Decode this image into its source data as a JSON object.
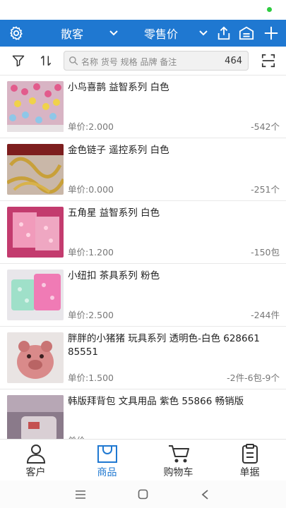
{
  "toolbar": {
    "customer": "散客",
    "price_type": "零售价",
    "colors": {
      "bar": "#1f78d1",
      "text": "#ffffff"
    }
  },
  "search": {
    "placeholder": "名称 货号 规格 品牌 备注",
    "count": "464"
  },
  "products": [
    {
      "name": "小鸟喜鹊  益智系列  白色",
      "price": "单价:2.000",
      "stock": "-542个",
      "thumb": "beads-pink"
    },
    {
      "name": "金色链子  遥控系列  白色",
      "price": "单价:0.000",
      "stock": "-251个",
      "thumb": "gold-chain"
    },
    {
      "name": "五角星  益智系列  白色",
      "price": "单价:1.200",
      "stock": "-150包",
      "thumb": "pink-stars"
    },
    {
      "name": "小纽扣  茶具系列  粉色",
      "price": "单价:2.500",
      "stock": "-244件",
      "thumb": "buttons"
    },
    {
      "name": "胖胖的小猪猪  玩具系列  透明色-白色 628661  85551",
      "price": "单价:1.500",
      "stock": "-2件-6包-9个",
      "thumb": "pig-toy"
    },
    {
      "name": "韩版拜背包  文具用品  紫色  55866  畅销版",
      "price": "单价:",
      "stock": "",
      "thumb": "backpack"
    }
  ],
  "nav": [
    {
      "label": "客户",
      "icon": "person-icon",
      "active": false
    },
    {
      "label": "商品",
      "icon": "bag-icon",
      "active": true
    },
    {
      "label": "购物车",
      "icon": "cart-icon",
      "active": false
    },
    {
      "label": "单据",
      "icon": "clipboard-icon",
      "active": false
    }
  ],
  "accent_color": "#1f78d1"
}
